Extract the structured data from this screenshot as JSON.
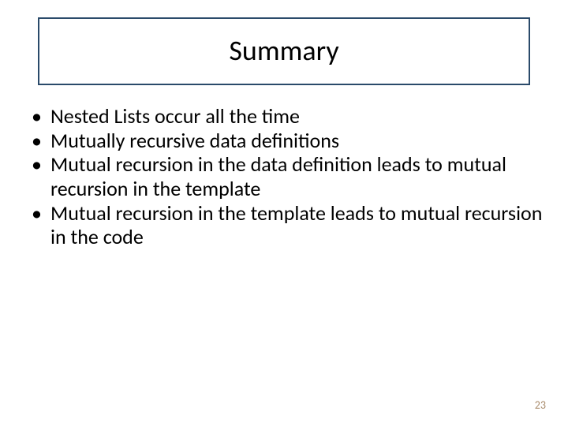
{
  "title": "Summary",
  "bullets": [
    "Nested Lists occur all the time",
    "Mutually recursive data definitions",
    "Mutual recursion in the data definition leads to mutual recursion in the template",
    "Mutual recursion in the template leads to mutual recursion in the code"
  ],
  "page_number": "23"
}
